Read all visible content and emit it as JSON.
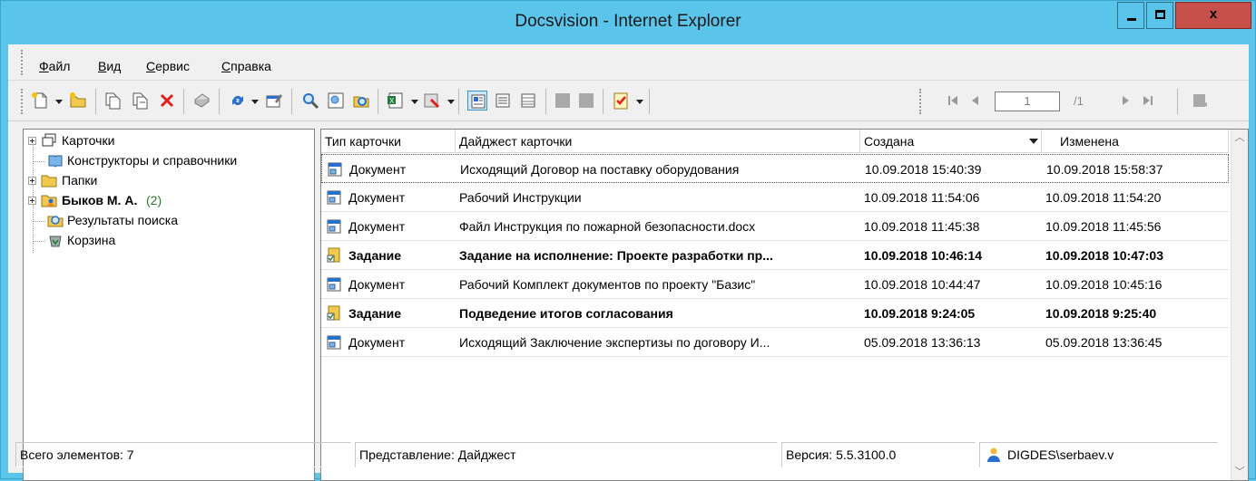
{
  "window": {
    "title": "Docsvision - Internet Explorer",
    "minimize_label": "_",
    "maximize_label": "□",
    "close_label": "x",
    "title_bg_color": "#5bc4ea",
    "close_color": "#c7504a"
  },
  "menu": [
    {
      "label": "Файл",
      "underline": "Ф",
      "rest": "айл"
    },
    {
      "label": "Вид",
      "underline": "В",
      "rest": "ид"
    },
    {
      "label": "Сервис",
      "underline": "С",
      "rest": "ервис"
    },
    {
      "label": "Справка",
      "underline": "С",
      "rest": "правка"
    }
  ],
  "toolbar": {
    "icons": [
      "new-card-icon",
      "new-folder-icon",
      "copy-icon",
      "paste-icon",
      "delete-icon",
      "print-icon",
      "refresh-icon",
      "properties-icon",
      "search-icon",
      "view-icon",
      "search-folder-icon",
      "export-excel-icon",
      "tools-icon",
      "view-digest-icon",
      "view-list-icon",
      "view-table-icon",
      "task-check-icon",
      "first-page-icon",
      "prev-page-icon",
      "next-page-icon",
      "last-page-icon",
      "exit-icon"
    ],
    "page_number": "1",
    "page_total": "/1"
  },
  "tree": [
    {
      "label": "Карточки",
      "icon": "cards-icon",
      "expandable": true,
      "bold": false,
      "count": ""
    },
    {
      "label": "Конструкторы и справочники",
      "icon": "book-icon",
      "expandable": false,
      "bold": false,
      "count": ""
    },
    {
      "label": "Папки",
      "icon": "folder-icon",
      "expandable": true,
      "bold": false,
      "count": ""
    },
    {
      "label": "Быков М. А.",
      "icon": "user-folder-icon",
      "expandable": true,
      "bold": true,
      "count": "(2)"
    },
    {
      "label": "Результаты поиска",
      "icon": "search-results-icon",
      "expandable": false,
      "bold": false,
      "count": ""
    },
    {
      "label": "Корзина",
      "icon": "recycle-bin-icon",
      "expandable": false,
      "bold": false,
      "count": ""
    }
  ],
  "columns": {
    "type": "Тип карточки",
    "digest": "Дайджест карточки",
    "created": "Создана",
    "modified": "Изменена"
  },
  "rows": [
    {
      "type": "Документ",
      "digest": "Исходящий Договор на поставку оборудования",
      "created": "10.09.2018 15:40:39",
      "modified": "10.09.2018 15:58:37",
      "bold": false,
      "icon": "document-icon"
    },
    {
      "type": "Документ",
      "digest": "Рабочий Инструкции",
      "created": "10.09.2018 11:54:06",
      "modified": "10.09.2018 11:54:20",
      "bold": false,
      "icon": "document-icon"
    },
    {
      "type": "Документ",
      "digest": "Файл Инструкция по пожарной безопасности.docx",
      "created": "10.09.2018 11:45:38",
      "modified": "10.09.2018 11:45:56",
      "bold": false,
      "icon": "document-icon"
    },
    {
      "type": "Задание",
      "digest": "Задание на исполнение: Проекте разработки пр...",
      "created": "10.09.2018 10:46:14",
      "modified": "10.09.2018 10:47:03",
      "bold": true,
      "icon": "task-icon"
    },
    {
      "type": "Документ",
      "digest": "Рабочий Комплект документов по проекту \"Базис\"",
      "created": "10.09.2018 10:44:47",
      "modified": "10.09.2018 10:45:16",
      "bold": false,
      "icon": "document-icon"
    },
    {
      "type": "Задание",
      "digest": "Подведение итогов согласования",
      "created": "10.09.2018 9:24:05",
      "modified": "10.09.2018 9:25:40",
      "bold": true,
      "icon": "task-icon"
    },
    {
      "type": "Документ",
      "digest": "Исходящий Заключение экспертизы по договору И...",
      "created": "05.09.2018 13:36:13",
      "modified": "05.09.2018 13:36:45",
      "bold": false,
      "icon": "document-icon"
    }
  ],
  "status": {
    "total": "Всего элементов: 7",
    "view": "Представление: Дайджест",
    "version": "Версия: 5.5.3100.0",
    "user": "DIGDES\\serbaev.v"
  }
}
